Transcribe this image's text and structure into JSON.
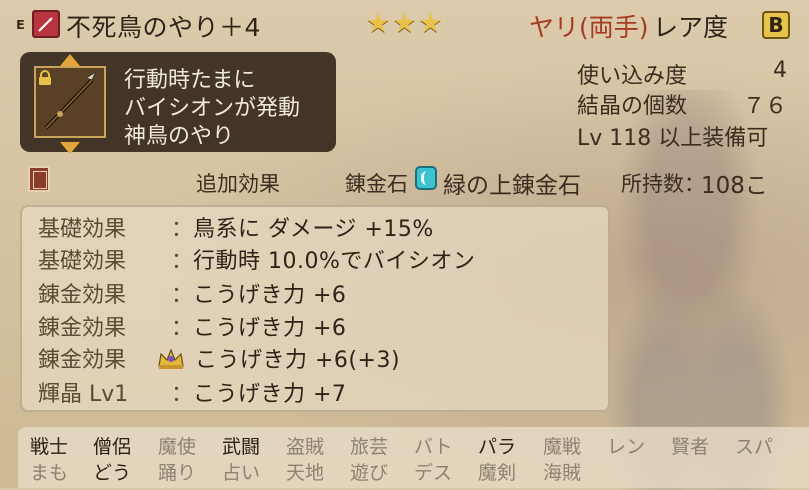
{
  "item": {
    "equip_mark": "E",
    "category_icon": "spear-icon",
    "name": "不死鳥のやり＋4",
    "stars": "★★★",
    "weapon_type": "ヤリ(両手)",
    "rarity_label": "レア度",
    "rarity_rank": "B"
  },
  "description": {
    "lines": [
      "行動時たまに",
      "バイシオンが発動",
      "神鳥のやり"
    ]
  },
  "stats": {
    "usage_label": "使い込み度",
    "usage_value": "4",
    "crystal_label": "結晶の個数",
    "crystal_value": "７６",
    "equip_level": "Lv 118 以上装備可"
  },
  "extra": {
    "header": "追加効果",
    "stone_label": "錬金石",
    "stone_name": "緑の上錬金石",
    "owned_label": "所持数：",
    "owned_count": "108こ"
  },
  "effects": [
    {
      "label": "基礎効果",
      "colon": "：",
      "value": "鳥系に ダメージ +15%"
    },
    {
      "label": "基礎効果",
      "colon": "：",
      "value": "行動時 10.0%でバイシオン"
    },
    {
      "label": "錬金効果",
      "colon": "：",
      "value": "こうげき力 +6"
    },
    {
      "label": "錬金効果",
      "colon": "：",
      "value": "こうげき力 +6"
    },
    {
      "label": "錬金効果",
      "colon": "",
      "value": "こうげき力 +6(+3)"
    },
    {
      "label": "輝晶 Lv1",
      "colon": "：",
      "value": "こうげき力 +7"
    }
  ],
  "jobs": {
    "row1": [
      "戦士",
      "僧侶",
      "魔使",
      "武闘",
      "盗賊",
      "旅芸",
      "バト",
      "パラ",
      "魔戦",
      "レン",
      "賢者",
      "スパ"
    ],
    "row2": [
      "まも",
      "どう",
      "踊り",
      "占い",
      "天地",
      "遊び",
      "デス",
      "魔剣",
      "海賊"
    ]
  },
  "colors": {
    "weapon_type": "#a63b22",
    "stars": "#e9c14a",
    "rank_badge": "#e6c34a",
    "job_enabled": "#2b2016",
    "job_disabled": "#8e8272"
  }
}
